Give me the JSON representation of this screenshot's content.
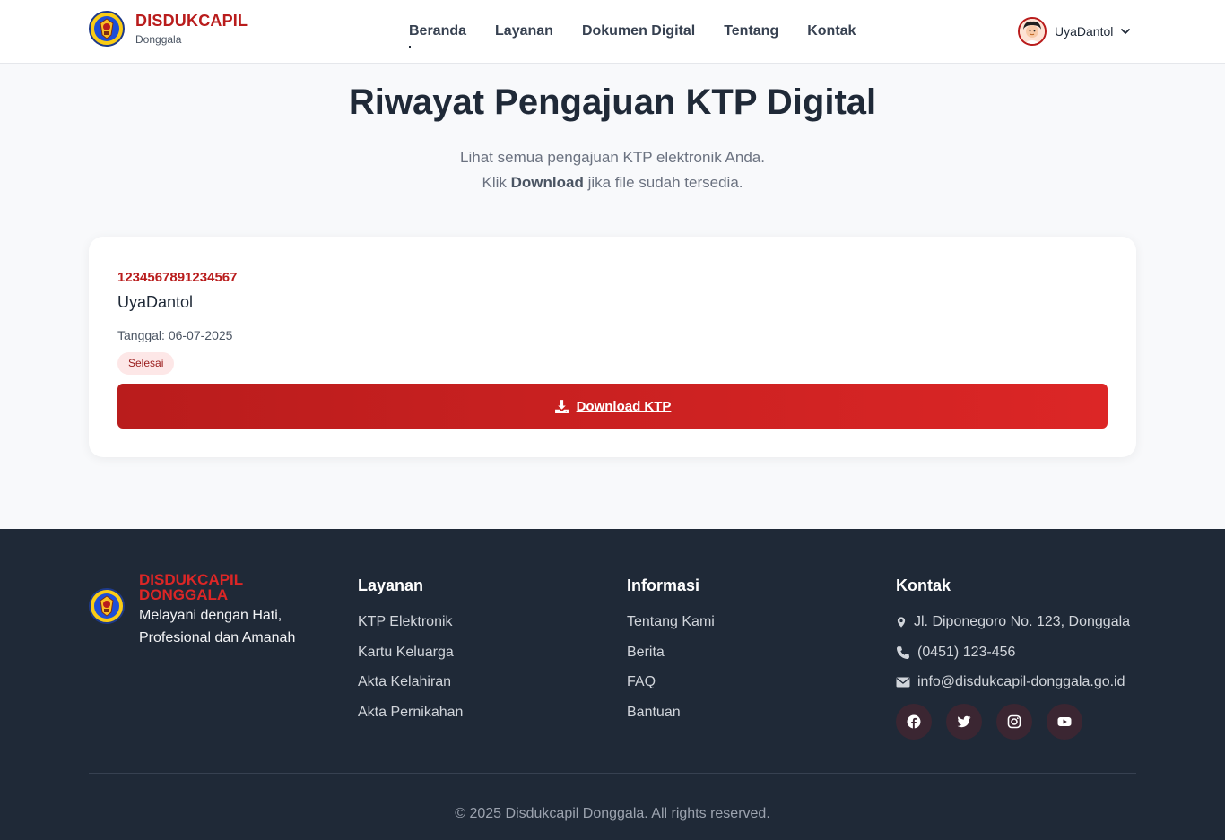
{
  "header": {
    "brand_title": "DISDUKCAPIL",
    "brand_sub": "Donggala",
    "nav": [
      {
        "label": "Beranda",
        "active": true
      },
      {
        "label": "Layanan",
        "active": false
      },
      {
        "label": "Dokumen Digital",
        "active": false
      },
      {
        "label": "Tentang",
        "active": false
      },
      {
        "label": "Kontak",
        "active": false
      }
    ],
    "user_name": "UyaDantol"
  },
  "main": {
    "title": "Riwayat Pengajuan KTP Digital",
    "subtitle_line1": "Lihat semua pengajuan KTP elektronik Anda.",
    "subtitle_pre": "Klik ",
    "subtitle_bold": "Download",
    "subtitle_post": " jika file sudah tersedia."
  },
  "submission": {
    "nik": "1234567891234567",
    "name": "UyaDantol",
    "date": "Tanggal: 06-07-2025",
    "status": "Selesai",
    "download_label": "Download KTP"
  },
  "footer": {
    "brand_title": "DISDUKCAPIL DONGGALA",
    "tagline": "Melayani dengan Hati, Profesional dan Amanah",
    "layanan": {
      "heading": "Layanan",
      "items": [
        "KTP Elektronik",
        "Kartu Keluarga",
        "Akta Kelahiran",
        "Akta Pernikahan"
      ]
    },
    "informasi": {
      "heading": "Informasi",
      "items": [
        "Tentang Kami",
        "Berita",
        "FAQ",
        "Bantuan"
      ]
    },
    "kontak": {
      "heading": "Kontak",
      "address": "Jl. Diponegoro No. 123, Donggala",
      "phone": "(0451) 123-456",
      "email": "info@disdukcapil-donggala.go.id"
    },
    "socials": [
      "facebook-icon",
      "twitter-icon",
      "instagram-icon",
      "youtube-icon"
    ],
    "copyright": "© 2025 Disdukcapil Donggala. All rights reserved."
  },
  "colors": {
    "brand_red": "#b91c1c",
    "footer_bg": "#1f2937",
    "button_gradient_end": "#dc2626"
  }
}
